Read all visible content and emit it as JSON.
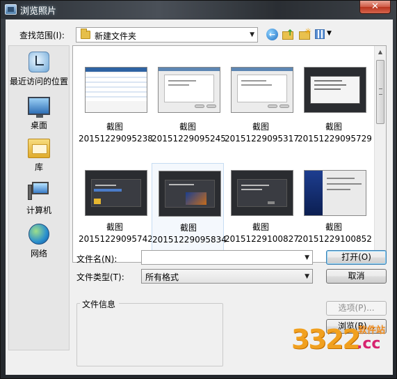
{
  "window": {
    "title": "浏览照片",
    "close_glyph": "✕"
  },
  "toolbar": {
    "lookin_label": "查找范围(I):",
    "lookin_value": "新建文件夹",
    "icons": [
      "back-icon",
      "up-folder-icon",
      "new-folder-icon",
      "view-menu-icon"
    ]
  },
  "places": [
    {
      "label": "最近访问的位置",
      "icon": "recent-places-icon"
    },
    {
      "label": "桌面",
      "icon": "desktop-icon"
    },
    {
      "label": "库",
      "icon": "library-icon"
    },
    {
      "label": "计算机",
      "icon": "computer-icon"
    },
    {
      "label": "网络",
      "icon": "network-icon"
    }
  ],
  "files": [
    {
      "name1": "截图",
      "name2": "20151229095238"
    },
    {
      "name1": "截图",
      "name2": "20151229095245"
    },
    {
      "name1": "截图",
      "name2": "20151229095317"
    },
    {
      "name1": "截图",
      "name2": "20151229095729"
    },
    {
      "name1": "截图",
      "name2": "20151229095742"
    },
    {
      "name1": "截图",
      "name2": "20151229095834"
    },
    {
      "name1": "截图",
      "name2": "20151229100827"
    },
    {
      "name1": "截图",
      "name2": "20151229100852"
    }
  ],
  "form": {
    "filename_label": "文件名(N):",
    "filename_value": "",
    "filetype_label": "文件类型(T):",
    "filetype_value": "所有格式",
    "info_label": "文件信息"
  },
  "buttons": {
    "open": "打开(O)",
    "cancel": "取消",
    "options": "选项(P)...",
    "browse": "浏览(B)..."
  },
  "watermark": {
    "number": "3322",
    "site": "软件站",
    "tld": ".cc"
  }
}
